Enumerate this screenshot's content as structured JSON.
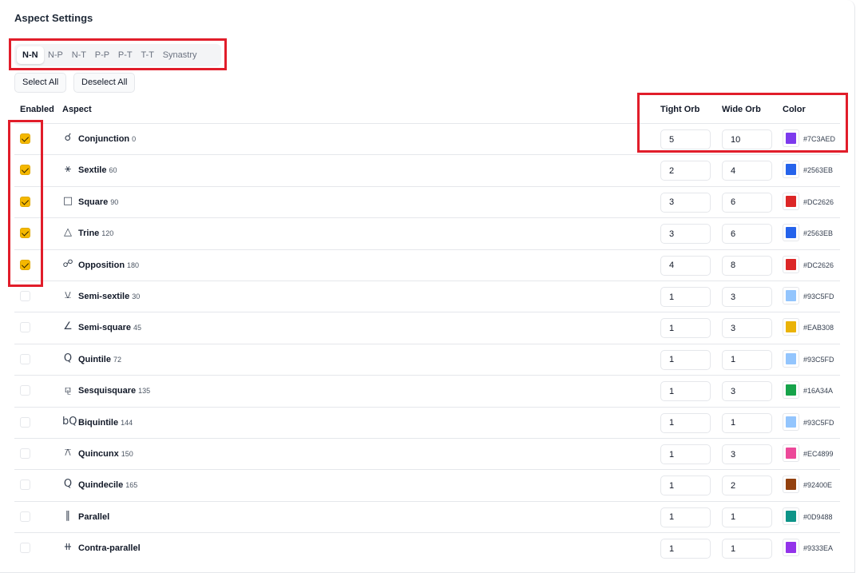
{
  "title": "Aspect Settings",
  "tabs": [
    {
      "label": "N-N",
      "active": true
    },
    {
      "label": "N-P",
      "active": false
    },
    {
      "label": "N-T",
      "active": false
    },
    {
      "label": "P-P",
      "active": false
    },
    {
      "label": "P-T",
      "active": false
    },
    {
      "label": "T-T",
      "active": false
    },
    {
      "label": "Synastry",
      "active": false
    }
  ],
  "buttons": {
    "select_all": "Select All",
    "deselect_all": "Deselect All"
  },
  "headers": {
    "enabled": "Enabled",
    "aspect": "Aspect",
    "tight_orb": "Tight Orb",
    "wide_orb": "Wide Orb",
    "color": "Color"
  },
  "aspects": [
    {
      "enabled": true,
      "icon": "conjunction-icon",
      "glyph": "☌",
      "name": "Conjunction",
      "degree": "0",
      "tight": "5",
      "wide": "10",
      "color": "#7C3AED"
    },
    {
      "enabled": true,
      "icon": "sextile-icon",
      "glyph": "⚹",
      "name": "Sextile",
      "degree": "60",
      "tight": "2",
      "wide": "4",
      "color": "#2563EB"
    },
    {
      "enabled": true,
      "icon": "square-icon",
      "glyph": "□",
      "name": "Square",
      "degree": "90",
      "tight": "3",
      "wide": "6",
      "color": "#DC2626"
    },
    {
      "enabled": true,
      "icon": "trine-icon",
      "glyph": "△",
      "name": "Trine",
      "degree": "120",
      "tight": "3",
      "wide": "6",
      "color": "#2563EB"
    },
    {
      "enabled": true,
      "icon": "opposition-icon",
      "glyph": "☍",
      "name": "Opposition",
      "degree": "180",
      "tight": "4",
      "wide": "8",
      "color": "#DC2626"
    },
    {
      "enabled": false,
      "icon": "semi-sextile-icon",
      "glyph": "⚺",
      "name": "Semi-sextile",
      "degree": "30",
      "tight": "1",
      "wide": "3",
      "color": "#93C5FD"
    },
    {
      "enabled": false,
      "icon": "semi-square-icon",
      "glyph": "∠",
      "name": "Semi-square",
      "degree": "45",
      "tight": "1",
      "wide": "3",
      "color": "#EAB308"
    },
    {
      "enabled": false,
      "icon": "quintile-icon",
      "glyph": "Q",
      "name": "Quintile",
      "degree": "72",
      "tight": "1",
      "wide": "1",
      "color": "#93C5FD"
    },
    {
      "enabled": false,
      "icon": "sesquisquare-icon",
      "glyph": "⚼",
      "name": "Sesquisquare",
      "degree": "135",
      "tight": "1",
      "wide": "3",
      "color": "#16A34A"
    },
    {
      "enabled": false,
      "icon": "biquintile-icon",
      "glyph": "bQ",
      "name": "Biquintile",
      "degree": "144",
      "tight": "1",
      "wide": "1",
      "color": "#93C5FD"
    },
    {
      "enabled": false,
      "icon": "quincunx-icon",
      "glyph": "⚻",
      "name": "Quincunx",
      "degree": "150",
      "tight": "1",
      "wide": "3",
      "color": "#EC4899"
    },
    {
      "enabled": false,
      "icon": "quindecile-icon",
      "glyph": "Q",
      "name": "Quindecile",
      "degree": "165",
      "tight": "1",
      "wide": "2",
      "color": "#92400E"
    },
    {
      "enabled": false,
      "icon": "parallel-icon",
      "glyph": "∥",
      "name": "Parallel",
      "degree": "",
      "tight": "1",
      "wide": "1",
      "color": "#0D9488"
    },
    {
      "enabled": false,
      "icon": "contra-parallel-icon",
      "glyph": "⧺",
      "name": "Contra-parallel",
      "degree": "",
      "tight": "1",
      "wide": "1",
      "color": "#9333EA"
    }
  ]
}
